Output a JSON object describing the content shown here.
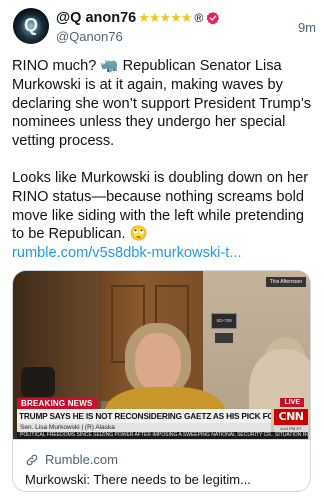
{
  "author": {
    "name": "@Q anon76",
    "stars": "★★★★★",
    "registered_mark": "®",
    "handle": "@Qanon76",
    "avatar_letter": "Q"
  },
  "timestamp": "9m",
  "post": {
    "paragraph1": "RINO much? 🦏 Republican Senator Lisa Murkowski is at it again, making waves by declaring she won’t support President Trump’s nominees unless they undergo her special vetting process.",
    "paragraph2": "Looks like Murkowski is doubling down on her RINO status—because nothing screams bold move like siding with the left while pretending to be Republican. 🙄",
    "link": "rumble.com/v5s8dbk-murkowski-t..."
  },
  "card": {
    "video": {
      "corner_label": "This Afternoon",
      "door_plaque": "SD-709",
      "breaking_label": "BREAKING NEWS",
      "live_label": "LIVE",
      "headline": "TRUMP SAYS HE IS NOT RECONSIDERING GAETZ AS HIS PICK FOR AG",
      "subline": "Sen. Lisa Murkowski  |  (R) Alaska",
      "ticker": "POLITICAL FREEDOMS SINCE SEIZING POWER AFTER IMPOSING A SWEEPING NATIONAL SECURITY CR.. SITUATION ROOM",
      "network": "CNN",
      "network_time": "6:10 PM ET"
    },
    "domain": "Rumble.com",
    "title": "Murkowski: There needs to be legitim..."
  },
  "colors": {
    "link": "#1d9bf0",
    "verified": "#e0245e",
    "stars": "#f5c518",
    "secondary_text": "#536471"
  }
}
